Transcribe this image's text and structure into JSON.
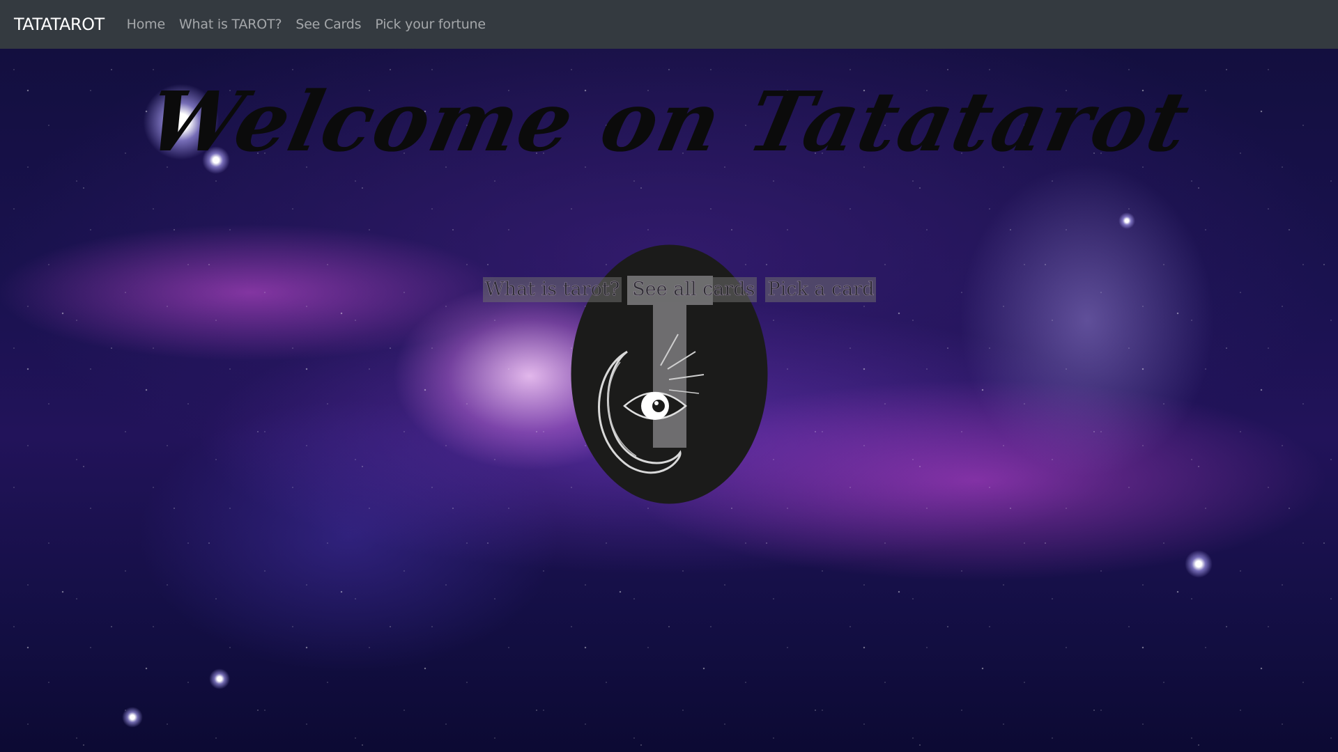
{
  "navbar": {
    "brand": "TATATAROT",
    "links": [
      {
        "label": "Home"
      },
      {
        "label": "What is TAROT?"
      },
      {
        "label": "See Cards"
      },
      {
        "label": "Pick your fortune"
      }
    ]
  },
  "hero": {
    "title": "Welcome on Tatatarot",
    "logo_icon": "tarot-eye-moon-logo-icon",
    "menu_links": [
      {
        "label": "What is tarot?"
      },
      {
        "label": "See all cards"
      },
      {
        "label": "Pick a card"
      }
    ]
  },
  "colors": {
    "navbar_bg": "#343a40",
    "nav_link": "rgba(255,255,255,0.55)",
    "title": "#0b0b0b",
    "logo_bg": "#1a1a1a"
  }
}
